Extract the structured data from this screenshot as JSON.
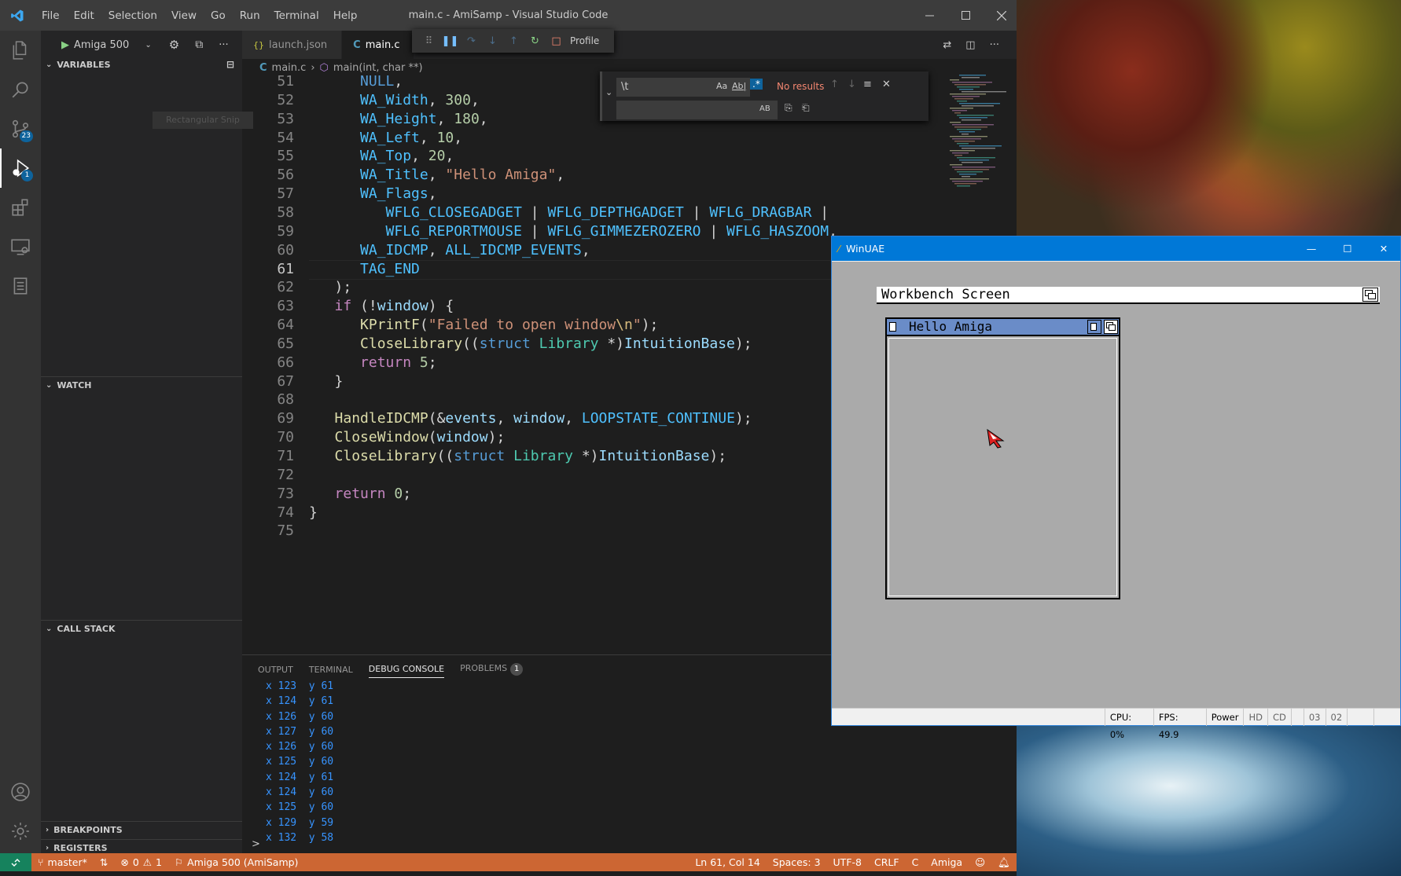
{
  "vscode": {
    "window_title": "main.c - AmiSamp - Visual Studio Code",
    "menu": [
      "File",
      "Edit",
      "Selection",
      "View",
      "Go",
      "Run",
      "Terminal",
      "Help"
    ],
    "activity_badges": {
      "scm": "23",
      "debug": "1"
    },
    "debug_config": "Amiga 500",
    "sidebar": {
      "variables": "VARIABLES",
      "watch": "WATCH",
      "call_stack": "CALL STACK",
      "breakpoints": "BREAKPOINTS",
      "registers": "REGISTERS",
      "snip_overlay": "Rectangular Snip"
    },
    "tabs": [
      {
        "label": "launch.json",
        "icon": "{}"
      },
      {
        "label": "main.c",
        "icon": "C"
      }
    ],
    "debug_toolbar": {
      "profile_label": "Profile"
    },
    "breadcrumb": {
      "file": "main.c",
      "symbol": "main(int, char **)"
    },
    "find_widget": {
      "search_value": "\\t",
      "options": [
        "Aa",
        "Ab|",
        ".*"
      ],
      "result": "No results",
      "replace_value": "",
      "preserve_case": "AB"
    },
    "current_line": 61,
    "code_lines": [
      {
        "n": "51",
        "t": [
          [
            "      ",
            ""
          ],
          [
            "NULL",
            "blu"
          ],
          [
            ",",
            ""
          ]
        ]
      },
      {
        "n": "52",
        "t": [
          [
            "      ",
            ""
          ],
          [
            "WA_Width",
            "cst"
          ],
          [
            ", ",
            ""
          ],
          [
            "300",
            "num"
          ],
          [
            ",",
            ""
          ]
        ]
      },
      {
        "n": "53",
        "t": [
          [
            "      ",
            ""
          ],
          [
            "WA_Height",
            "cst"
          ],
          [
            ", ",
            ""
          ],
          [
            "180",
            "num"
          ],
          [
            ",",
            ""
          ]
        ]
      },
      {
        "n": "54",
        "t": [
          [
            "      ",
            ""
          ],
          [
            "WA_Left",
            "cst"
          ],
          [
            ", ",
            ""
          ],
          [
            "10",
            "num"
          ],
          [
            ",",
            ""
          ]
        ]
      },
      {
        "n": "55",
        "t": [
          [
            "      ",
            ""
          ],
          [
            "WA_Top",
            "cst"
          ],
          [
            ", ",
            ""
          ],
          [
            "20",
            "num"
          ],
          [
            ",",
            ""
          ]
        ]
      },
      {
        "n": "56",
        "t": [
          [
            "      ",
            ""
          ],
          [
            "WA_Title",
            "cst"
          ],
          [
            ", ",
            ""
          ],
          [
            "\"Hello Amiga\"",
            "str"
          ],
          [
            ",",
            ""
          ]
        ]
      },
      {
        "n": "57",
        "t": [
          [
            "      ",
            ""
          ],
          [
            "WA_Flags",
            "cst"
          ],
          [
            ",",
            ""
          ]
        ]
      },
      {
        "n": "58",
        "t": [
          [
            "         ",
            ""
          ],
          [
            "WFLG_CLOSEGADGET",
            "cst"
          ],
          [
            " | ",
            ""
          ],
          [
            "WFLG_DEPTHGADGET",
            "cst"
          ],
          [
            " | ",
            ""
          ],
          [
            "WFLG_DRAGBAR",
            "cst"
          ],
          [
            " |",
            ""
          ]
        ]
      },
      {
        "n": "59",
        "t": [
          [
            "         ",
            ""
          ],
          [
            "WFLG_REPORTMOUSE",
            "cst"
          ],
          [
            " | ",
            ""
          ],
          [
            "WFLG_GIMMEZEROZERO",
            "cst"
          ],
          [
            " | ",
            ""
          ],
          [
            "WFLG_HASZOOM",
            "cst"
          ],
          [
            ",",
            ""
          ]
        ]
      },
      {
        "n": "60",
        "t": [
          [
            "      ",
            ""
          ],
          [
            "WA_IDCMP",
            "cst"
          ],
          [
            ", ",
            ""
          ],
          [
            "ALL_IDCMP_EVENTS",
            "cst"
          ],
          [
            ",",
            ""
          ]
        ]
      },
      {
        "n": "61",
        "t": [
          [
            "      ",
            ""
          ],
          [
            "TAG_END",
            "cst"
          ]
        ]
      },
      {
        "n": "62",
        "t": [
          [
            "   ",
            ""
          ],
          [
            ");",
            ""
          ]
        ]
      },
      {
        "n": "63",
        "t": [
          [
            "   ",
            ""
          ],
          [
            "if",
            "kw"
          ],
          [
            " (!",
            ""
          ],
          [
            "window",
            "var"
          ],
          [
            ") {",
            ""
          ]
        ]
      },
      {
        "n": "64",
        "t": [
          [
            "      ",
            ""
          ],
          [
            "KPrintF",
            "fn"
          ],
          [
            "(",
            ""
          ],
          [
            "\"Failed to open window",
            "str"
          ],
          [
            "\\n",
            "esc"
          ],
          [
            "\"",
            "str"
          ],
          [
            ");",
            ""
          ]
        ]
      },
      {
        "n": "65",
        "t": [
          [
            "      ",
            ""
          ],
          [
            "CloseLibrary",
            "fn"
          ],
          [
            "((",
            ""
          ],
          [
            "struct",
            "blu"
          ],
          [
            " ",
            ""
          ],
          [
            "Library",
            "ty"
          ],
          [
            " *)",
            ""
          ],
          [
            "IntuitionBase",
            "var"
          ],
          [
            ");",
            ""
          ]
        ]
      },
      {
        "n": "66",
        "t": [
          [
            "      ",
            ""
          ],
          [
            "return",
            "kw"
          ],
          [
            " ",
            ""
          ],
          [
            "5",
            "num"
          ],
          [
            ";",
            ""
          ]
        ]
      },
      {
        "n": "67",
        "t": [
          [
            "   ",
            ""
          ],
          [
            "}",
            ""
          ]
        ]
      },
      {
        "n": "68",
        "t": []
      },
      {
        "n": "69",
        "t": [
          [
            "   ",
            ""
          ],
          [
            "HandleIDCMP",
            "fn"
          ],
          [
            "(&",
            ""
          ],
          [
            "events",
            "var"
          ],
          [
            ", ",
            ""
          ],
          [
            "window",
            "var"
          ],
          [
            ", ",
            ""
          ],
          [
            "LOOPSTATE_CONTINUE",
            "cst"
          ],
          [
            ");",
            ""
          ]
        ]
      },
      {
        "n": "70",
        "t": [
          [
            "   ",
            ""
          ],
          [
            "CloseWindow",
            "fn"
          ],
          [
            "(",
            ""
          ],
          [
            "window",
            "var"
          ],
          [
            ");",
            ""
          ]
        ]
      },
      {
        "n": "71",
        "t": [
          [
            "   ",
            ""
          ],
          [
            "CloseLibrary",
            "fn"
          ],
          [
            "((",
            ""
          ],
          [
            "struct",
            "blu"
          ],
          [
            " ",
            ""
          ],
          [
            "Library",
            "ty"
          ],
          [
            " *)",
            ""
          ],
          [
            "IntuitionBase",
            "var"
          ],
          [
            ");",
            ""
          ]
        ]
      },
      {
        "n": "72",
        "t": []
      },
      {
        "n": "73",
        "t": [
          [
            "   ",
            ""
          ],
          [
            "return",
            "kw"
          ],
          [
            " ",
            ""
          ],
          [
            "0",
            "num"
          ],
          [
            ";",
            ""
          ]
        ]
      },
      {
        "n": "74",
        "t": [
          [
            "",
            ""
          ],
          [
            "}",
            ""
          ]
        ]
      },
      {
        "n": "75",
        "t": []
      }
    ],
    "panel": {
      "tabs": [
        "OUTPUT",
        "TERMINAL",
        "DEBUG CONSOLE",
        "PROBLEMS"
      ],
      "active_tab": "DEBUG CONSOLE",
      "problems_count": "1",
      "console_lines": [
        "x 123  y 61",
        "x 124  y 61",
        "x 126  y 60",
        "x 127  y 60",
        "x 126  y 60",
        "x 125  y 60",
        "x 124  y 61",
        "x 124  y 60",
        "x 125  y 60",
        "x 129  y 59",
        "x 132  y 58"
      ],
      "prompt": ">"
    },
    "statusbar": {
      "branch": "master*",
      "errors": "0",
      "warnings": "1",
      "debug_target": "Amiga 500 (AmiSamp)",
      "position": "Ln 61, Col 14",
      "spaces": "Spaces: 3",
      "encoding": "UTF-8",
      "eol": "CRLF",
      "language": "C",
      "target": "Amiga"
    },
    "colors": {
      "statusbar": "#cc6633",
      "accent": "#0e639c"
    }
  },
  "winuae": {
    "title": "WinUAE",
    "screen_title": "Workbench Screen",
    "window_title": "Hello Amiga",
    "status": {
      "cpu": "CPU: 0%",
      "fps": "FPS: 49.9",
      "power": "Power",
      "hd": "HD",
      "cd": "CD",
      "df0": "03",
      "df1": "02"
    }
  }
}
